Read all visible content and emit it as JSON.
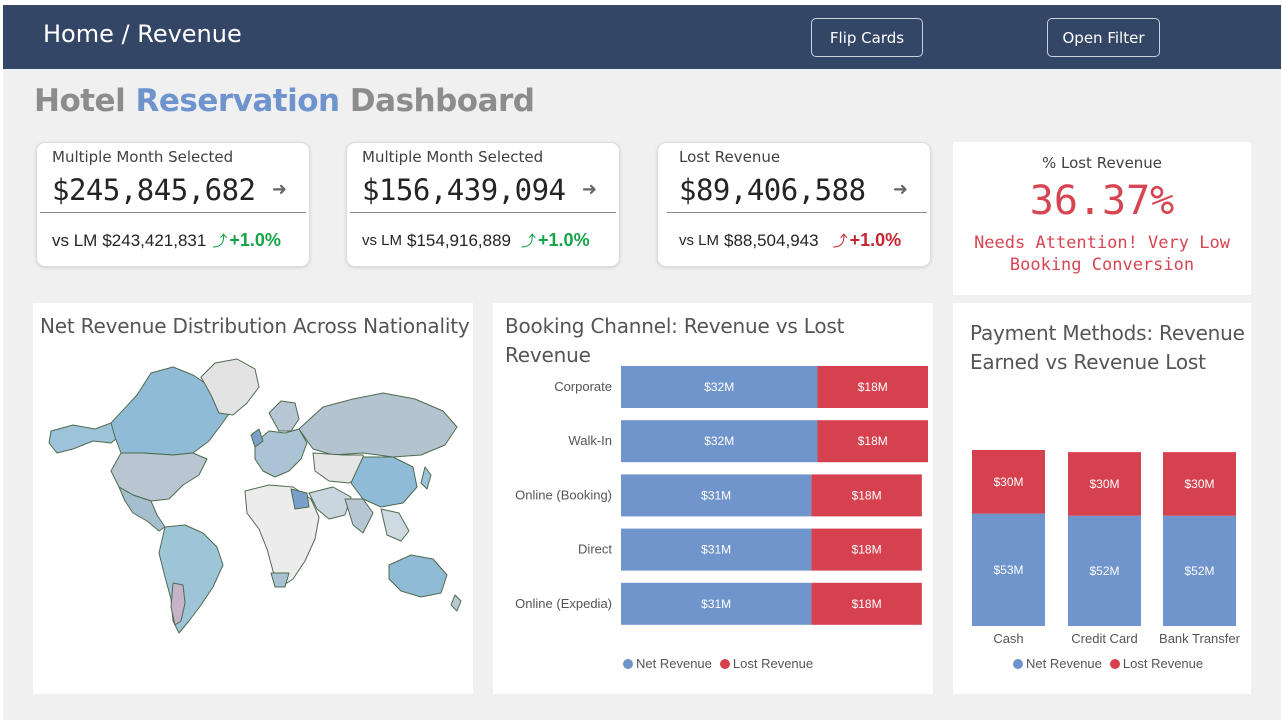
{
  "header": {
    "breadcrumb": "Home / Revenue",
    "flip_cards_label": "Flip Cards",
    "open_filter_label": "Open Filter"
  },
  "page_title": {
    "word1": "Hotel",
    "word2": "Reservation",
    "word3": "Dashboard"
  },
  "cards": [
    {
      "label": "Multiple Month Selected",
      "value": "$245,845,682",
      "vs_prefix": "vs LM",
      "lm_value": "$243,421,831",
      "change": "+1.0%",
      "trend": "up-good"
    },
    {
      "label": "Multiple Month Selected",
      "value": "$156,439,094",
      "vs_prefix": "vs LM",
      "lm_value": "$154,916,889",
      "change": "+1.0%",
      "trend": "up-good"
    },
    {
      "label": "Lost Revenue",
      "value": "$89,406,588",
      "vs_prefix": "vs LM",
      "lm_value": "$88,504,943",
      "change": "+1.0%",
      "trend": "up-bad"
    }
  ],
  "lost_revenue": {
    "label": "% Lost Revenue",
    "value": "36.37%",
    "note": "Needs Attention! Very Low Booking Conversion"
  },
  "colors": {
    "header_bg": "#344666",
    "net_revenue": "#7094cc",
    "lost_revenue": "#d6414f",
    "positive": "#16a34a",
    "negative": "#c6242f"
  },
  "map": {
    "title": "Net Revenue Distribution Across Nationality"
  },
  "chart_data": [
    {
      "type": "bar",
      "orientation": "horizontal",
      "stacked": true,
      "title": "Booking Channel: Revenue vs Lost Revenue",
      "categories": [
        "Corporate",
        "Walk-In",
        "Online (Booking)",
        "Direct",
        "Online (Expedia)"
      ],
      "series": [
        {
          "name": "Net Revenue",
          "values": [
            32,
            32,
            31,
            31,
            31
          ],
          "labels": [
            "$32M",
            "$32M",
            "$31M",
            "$31M",
            "$31M"
          ]
        },
        {
          "name": "Lost Revenue",
          "values": [
            18,
            18,
            18,
            18,
            18
          ],
          "labels": [
            "$18M",
            "$18M",
            "$18M",
            "$18M",
            "$18M"
          ]
        }
      ],
      "legend": "bottom"
    },
    {
      "type": "bar",
      "orientation": "vertical",
      "stacked": true,
      "title": "Payment Methods: Revenue Earned vs Revenue Lost",
      "categories": [
        "Cash",
        "Credit Card",
        "Bank Transfer"
      ],
      "series": [
        {
          "name": "Net Revenue",
          "values": [
            53,
            52,
            52
          ],
          "labels": [
            "$53M",
            "$52M",
            "$52M"
          ]
        },
        {
          "name": "Lost Revenue",
          "values": [
            30,
            30,
            30
          ],
          "labels": [
            "$30M",
            "$30M",
            "$30M"
          ]
        }
      ],
      "legend": "bottom"
    }
  ]
}
